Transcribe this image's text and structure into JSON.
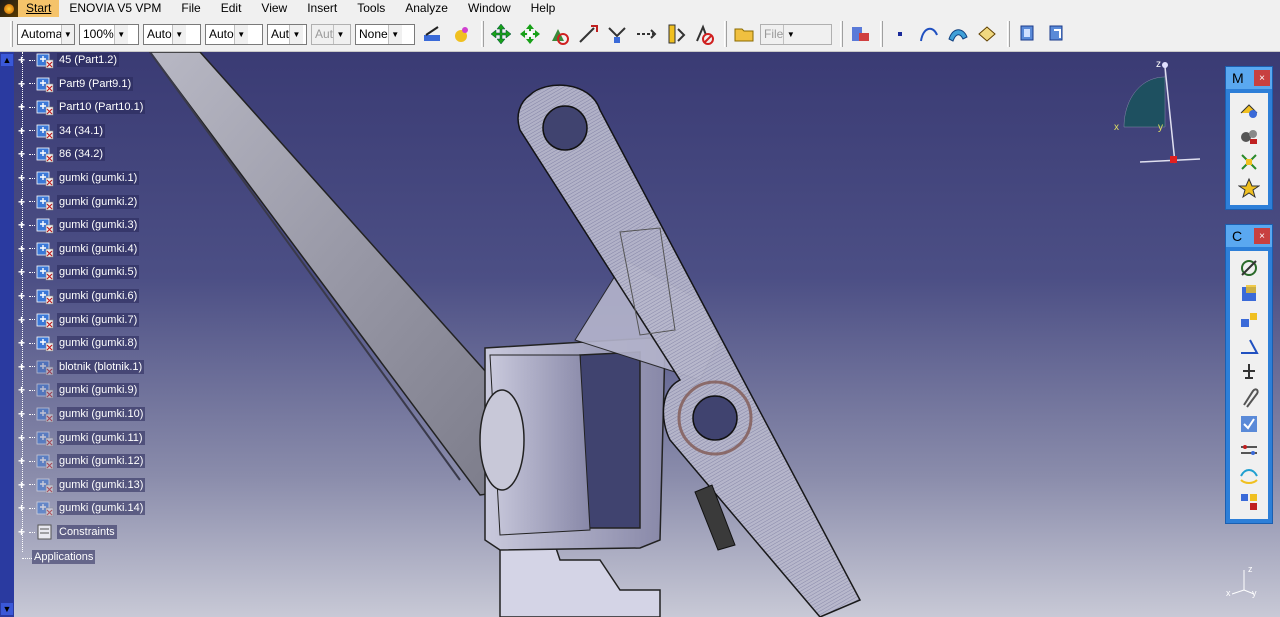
{
  "menubar": {
    "start": "Start",
    "items": [
      "ENOVIA V5 VPM",
      "File",
      "Edit",
      "View",
      "Insert",
      "Tools",
      "Analyze",
      "Window",
      "Help"
    ]
  },
  "toolbar": {
    "combos": [
      {
        "value": "Automa",
        "disabled": false
      },
      {
        "value": "100%",
        "disabled": false
      },
      {
        "value": "Auto",
        "disabled": false
      },
      {
        "value": "Auto",
        "disabled": false
      },
      {
        "value": "Aut",
        "disabled": false
      },
      {
        "value": "Aut",
        "disabled": true
      },
      {
        "value": "None",
        "disabled": false
      }
    ],
    "file_combo": "File"
  },
  "tree": {
    "nodes": [
      {
        "label": "45 (Part1.2)",
        "kind": "part"
      },
      {
        "label": "Part9 (Part9.1)",
        "kind": "part"
      },
      {
        "label": "Part10 (Part10.1)",
        "kind": "part"
      },
      {
        "label": "34 (34.1)",
        "kind": "part"
      },
      {
        "label": "86 (34.2)",
        "kind": "part"
      },
      {
        "label": "gumki (gumki.1)",
        "kind": "part"
      },
      {
        "label": "gumki (gumki.2)",
        "kind": "part"
      },
      {
        "label": "gumki (gumki.3)",
        "kind": "part"
      },
      {
        "label": "gumki (gumki.4)",
        "kind": "part"
      },
      {
        "label": "gumki (gumki.5)",
        "kind": "part"
      },
      {
        "label": "gumki (gumki.6)",
        "kind": "part"
      },
      {
        "label": "gumki (gumki.7)",
        "kind": "part"
      },
      {
        "label": "gumki (gumki.8)",
        "kind": "part"
      },
      {
        "label": "blotnik (blotnik.1)",
        "kind": "hidden"
      },
      {
        "label": "gumki (gumki.9)",
        "kind": "hidden"
      },
      {
        "label": "gumki (gumki.10)",
        "kind": "hidden"
      },
      {
        "label": "gumki (gumki.11)",
        "kind": "hidden"
      },
      {
        "label": "gumki (gumki.12)",
        "kind": "hidden"
      },
      {
        "label": "gumki (gumki.13)",
        "kind": "hidden"
      },
      {
        "label": "gumki (gumki.14)",
        "kind": "hidden"
      },
      {
        "label": "Constraints",
        "kind": "constraints"
      }
    ],
    "applications": "Applications"
  },
  "panels": [
    {
      "title": "M",
      "close": "×",
      "icons": [
        "product-icon",
        "scene-icon",
        "explode-icon",
        "snap-icon"
      ]
    },
    {
      "title": "C",
      "close": "×",
      "icons": [
        "coincidence-icon",
        "contact-icon",
        "offset-icon",
        "angle-icon",
        "fix-icon",
        "fix-together-icon",
        "quick-constraint-icon",
        "flexible-icon",
        "change-constraint-icon",
        "reuse-pattern-icon"
      ]
    }
  ],
  "compass": {
    "z": "z",
    "x": "x",
    "y": "y"
  },
  "axis": {
    "z": "z",
    "x": "x",
    "y": "y"
  },
  "colors": {
    "viewport_top": "#3a3b74",
    "viewport_bottom": "#c8c9d6",
    "start_bg": "#f5c36a"
  }
}
